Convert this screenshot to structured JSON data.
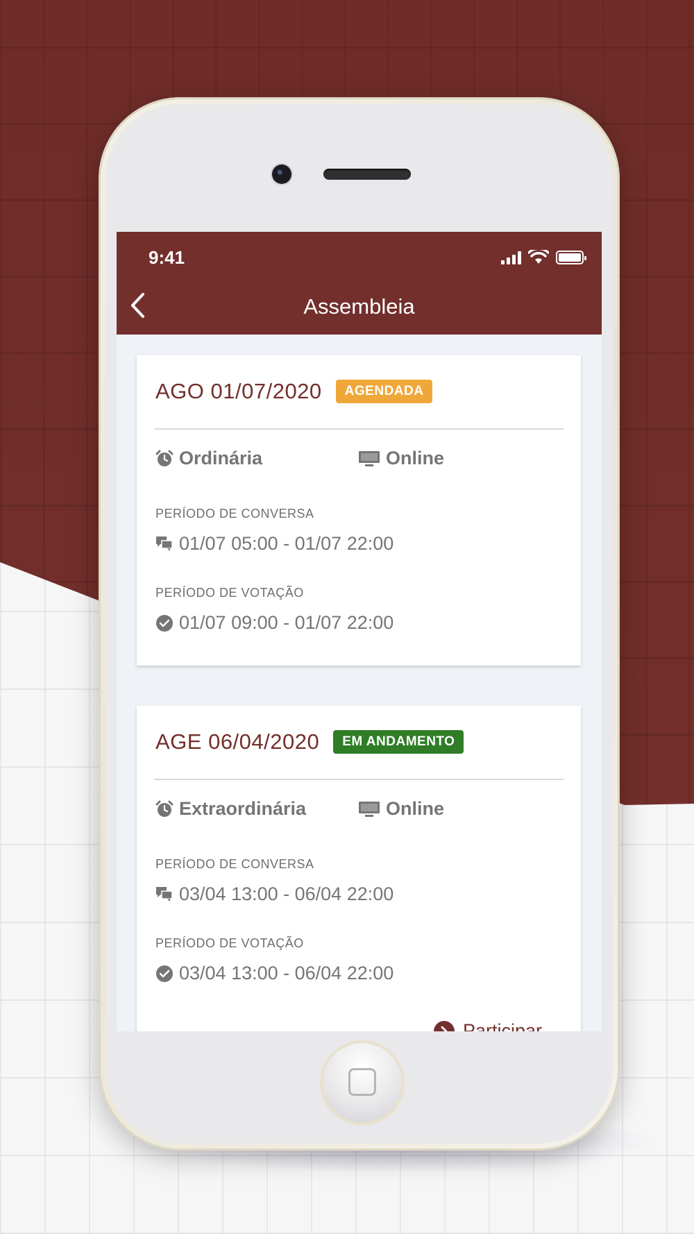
{
  "status_bar": {
    "time": "9:41"
  },
  "header": {
    "title": "Assembleia"
  },
  "colors": {
    "brand": "#722f2b",
    "agendada": "#f0a73a",
    "em_andamento": "#2f7d27"
  },
  "assemblies": [
    {
      "title": "AGO 01/07/2020",
      "status": "AGENDADA",
      "type": "Ordinária",
      "mode": "Online",
      "conversation_label": "PERÍODO DE CONVERSA",
      "conversation_period": "01/07 05:00 - 01/07 22:00",
      "voting_label": "PERÍODO DE VOTAÇÃO",
      "voting_period": "01/07 09:00 - 01/07 22:00"
    },
    {
      "title": "AGE 06/04/2020",
      "status": "EM ANDAMENTO",
      "type": "Extraordinária",
      "mode": "Online",
      "conversation_label": "PERÍODO DE CONVERSA",
      "conversation_period": "03/04 13:00 - 06/04 22:00",
      "voting_label": "PERÍODO DE VOTAÇÃO",
      "voting_period": "03/04 13:00 - 06/04 22:00",
      "action_label": "Participar"
    }
  ]
}
